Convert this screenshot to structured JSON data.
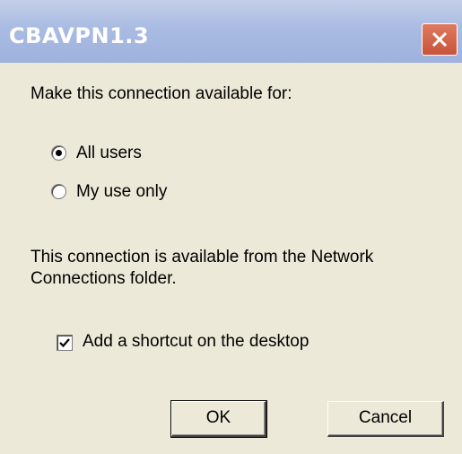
{
  "dialog": {
    "title": "CBAVPN1.3",
    "prompt": "Make this connection available for:",
    "options": [
      {
        "label": "All users",
        "selected": true
      },
      {
        "label": "My use only",
        "selected": false
      }
    ],
    "info_line1": "This connection is available from the Network",
    "info_line2": "Connections folder.",
    "shortcut_label": "Add a shortcut on the desktop",
    "shortcut_checked": true,
    "ok_label": "OK",
    "cancel_label": "Cancel"
  },
  "colors": {
    "background": "#ece9d8",
    "titlebar": "#a9bbe2",
    "close_button": "#c8543a"
  }
}
